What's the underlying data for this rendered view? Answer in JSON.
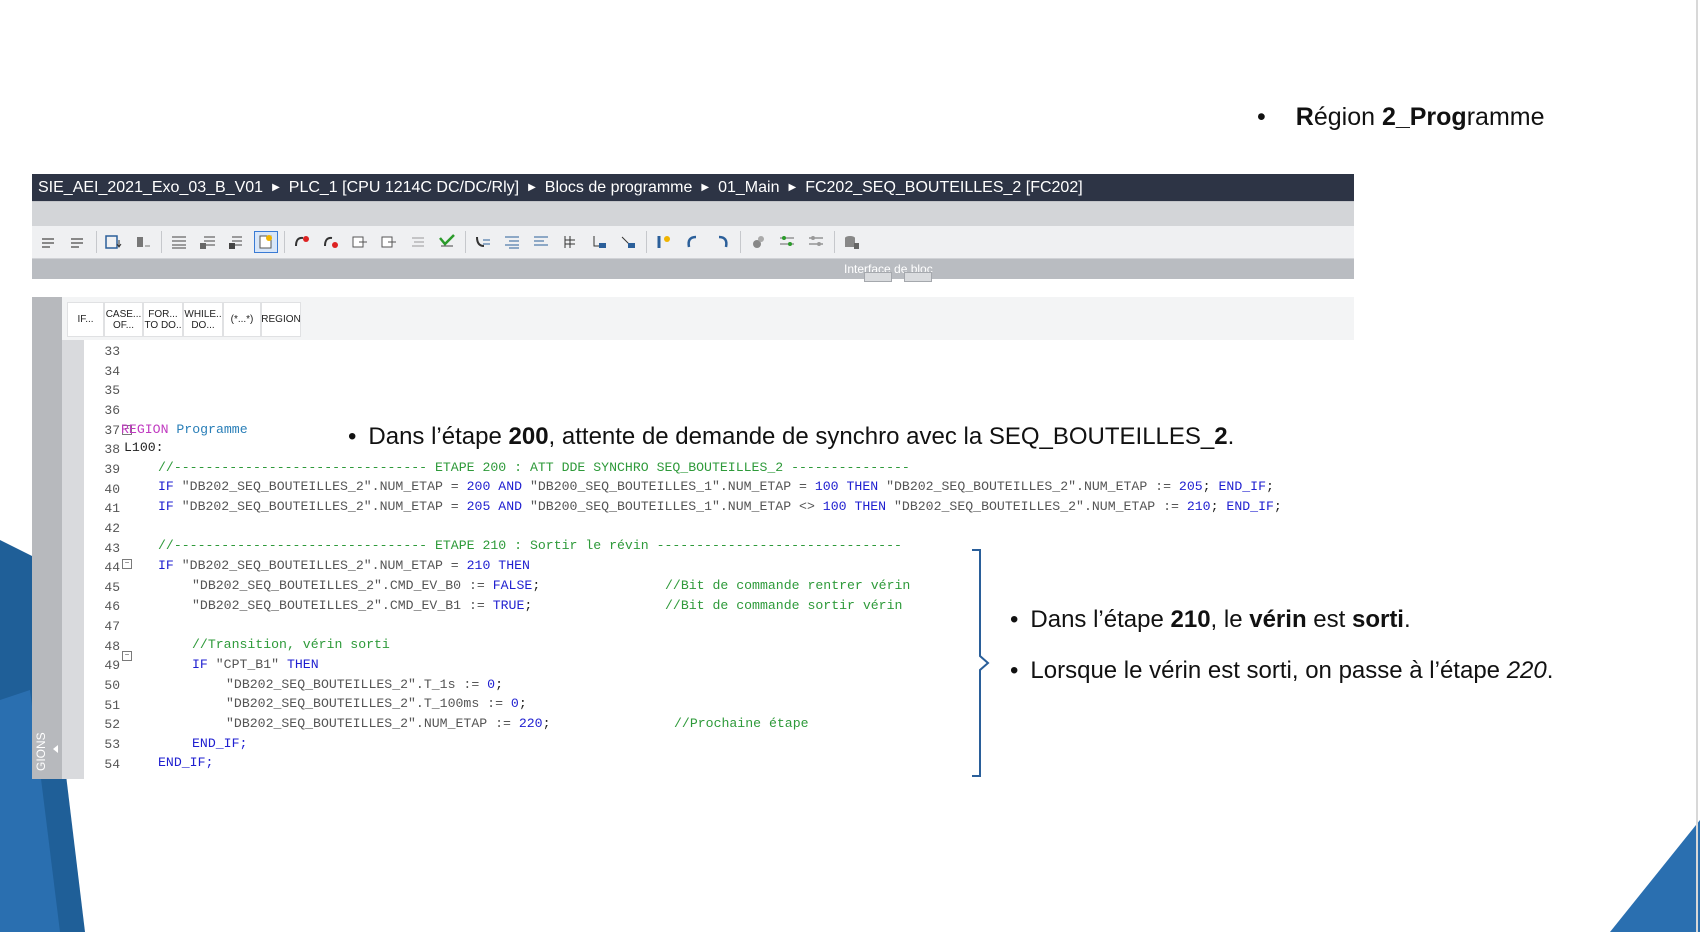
{
  "slide": {
    "region_title_bullet": "•",
    "region_title_parts": [
      "R",
      "égion ",
      "2_Prog",
      "ramme"
    ],
    "note_200": {
      "bullet": "•",
      "pre": "Dans l’étape ",
      "num": "200",
      "post": ", attente de demande de synchro avec la SEQ_BOUTEILLES_",
      "num2": "2",
      "end": "."
    },
    "note_210": {
      "bullet": "•",
      "pre": "Dans l’étape ",
      "num": "210",
      "mid1": ", le ",
      "word1": "vérin",
      "mid2": " est ",
      "word2": "sorti",
      "end": "."
    },
    "note_220": {
      "bullet": "•",
      "pre": "Lorsque le vérin est sorti, on passe à l’étape ",
      "num": "220",
      "end": "."
    },
    "colors": {
      "accent": "#2a6fb0",
      "breadcrumb_bg": "#2d3445"
    }
  },
  "breadcrumb": [
    "SIE_AEI_2021_Exo_03_B_V01",
    "PLC_1 [CPU 1214C DC/DC/Rly]",
    "Blocs de programme",
    "01_Main",
    "FC202_SEQ_BOUTEILLES_2 [FC202]"
  ],
  "interface_label": "Interface de bloc",
  "snippets": [
    {
      "line1": "IF...",
      "line2": ""
    },
    {
      "line1": "CASE...",
      "line2": "OF..."
    },
    {
      "line1": "FOR...",
      "line2": "TO DO.."
    },
    {
      "line1": "WHILE..",
      "line2": "DO..."
    },
    {
      "line1": "(*...*)",
      "line2": ""
    },
    {
      "line1": "REGION",
      "line2": ""
    }
  ],
  "side_label": "GIONS",
  "line_numbers": [
    "33",
    "34",
    "35",
    "36",
    "37",
    "38",
    "39",
    "40",
    "41",
    "42",
    "43",
    "44",
    "45",
    "46",
    "47",
    "48",
    "49",
    "50",
    "51",
    "52",
    "53",
    "54"
  ],
  "code": {
    "l37_kw": "REGION",
    "l37_name": " Programme",
    "l38": "L100:",
    "l39": "//-------------------------------- ETAPE 200 : ATT DDE SYNCHRO SEQ_BOUTEILLES_2 ---------------",
    "l40_a": "IF",
    "l40_b": " \"DB202_SEQ_BOUTEILLES_2\".NUM_ETAP = ",
    "l40_c": "200",
    "l40_d": " AND",
    "l40_e": " \"DB200_SEQ_BOUTEILLES_1\".NUM_ETAP = ",
    "l40_f": "100",
    "l40_g": " THEN",
    "l40_h": " \"DB202_SEQ_BOUTEILLES_2\".NUM_ETAP := ",
    "l40_i": "205",
    "l40_j": "; ",
    "l40_k": "END_IF",
    "l40_l": ";",
    "l41_a": "IF",
    "l41_b": " \"DB202_SEQ_BOUTEILLES_2\".NUM_ETAP = ",
    "l41_c": "205",
    "l41_d": " AND",
    "l41_e": " \"DB200_SEQ_BOUTEILLES_1\".NUM_ETAP <> ",
    "l41_f": "100",
    "l41_g": " THEN",
    "l41_h": " \"DB202_SEQ_BOUTEILLES_2\".NUM_ETAP := ",
    "l41_i": "210",
    "l41_j": "; ",
    "l41_k": "END_IF",
    "l41_l": ";",
    "l43": "//-------------------------------- ETAPE 210 : Sortir le révin -------------------------------",
    "l44_a": "IF",
    "l44_b": " \"DB202_SEQ_BOUTEILLES_2\".NUM_ETAP = ",
    "l44_c": "210",
    "l44_d": " THEN",
    "l45_a": "\"DB202_SEQ_BOUTEILLES_2\".CMD_EV_B0 := ",
    "l45_b": "FALSE",
    "l45_c": ";",
    "l45_cm": "//Bit de commande rentrer vérin",
    "l46_a": "\"DB202_SEQ_BOUTEILLES_2\".CMD_EV_B1 := ",
    "l46_b": "TRUE",
    "l46_c": ";",
    "l46_cm": "//Bit de commande sortir vérin",
    "l48": "//Transition, vérin sorti",
    "l49_a": "IF",
    "l49_b": " \"CPT_B1\"",
    "l49_c": " THEN",
    "l50_a": "\"DB202_SEQ_BOUTEILLES_2\".T_1s := ",
    "l50_b": "0",
    "l50_c": ";",
    "l51_a": "\"DB202_SEQ_BOUTEILLES_2\".T_100ms := ",
    "l51_b": "0",
    "l51_c": ";",
    "l52_a": "\"DB202_SEQ_BOUTEILLES_2\".NUM_ETAP := ",
    "l52_b": "220",
    "l52_c": ";",
    "l52_cm": "//Prochaine étape",
    "l53": "END_IF;",
    "l54": "END_IF;"
  },
  "toolbar_icons": [
    "insert-network-icon",
    "remove-network-icon",
    "download-block-icon",
    "monitor-icon",
    "indent-icon",
    "outdent-icon",
    "comment-icon",
    "bookmark-icon",
    "breakpoint-icon",
    "next-error-icon",
    "prev-error-icon",
    "compare-icon",
    "list-icon",
    "check-icon",
    "call-icon",
    "align-icon",
    "outline-icon",
    "jump-icon",
    "go-to-line-icon",
    "open-icon",
    "reload-icon",
    "sync-icon",
    "network-icon",
    "watch-icon",
    "settings-icon",
    "db-icon"
  ]
}
